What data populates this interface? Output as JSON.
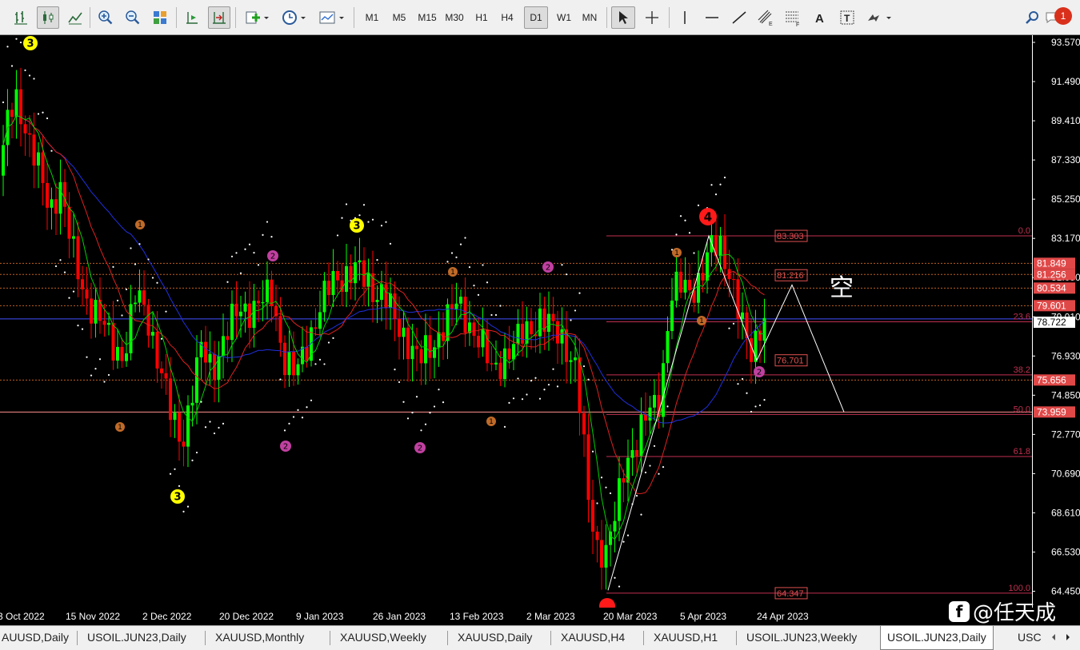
{
  "toolbar": {
    "timeframes": [
      "M1",
      "M5",
      "M15",
      "M30",
      "H1",
      "H4",
      "D1",
      "W1",
      "MN"
    ],
    "active_timeframe": "D1",
    "notifications_count": "1",
    "icons": [
      "bar-chart-icon",
      "candlestick-icon",
      "line-chart-icon",
      "zoom-in-icon",
      "zoom-out-icon",
      "tile-windows-icon",
      "autoscroll-icon",
      "chart-shift-icon",
      "new-order-icon",
      "periods-clock-icon",
      "templates-icon",
      "cursor-icon",
      "crosshair-icon",
      "vertical-line-icon",
      "horizontal-line-icon",
      "trendline-icon",
      "equidistant-channel-icon",
      "fibonacci-icon",
      "text-icon",
      "text-label-icon",
      "arrow-shapes-icon",
      "search-icon"
    ]
  },
  "price_axis": {
    "ticks": [
      "93.570",
      "91.490",
      "89.410",
      "87.330",
      "85.250",
      "83.170",
      "81.090",
      "79.010",
      "76.930",
      "74.850",
      "72.770",
      "70.690",
      "68.610",
      "66.530",
      "64.450"
    ],
    "labels": [
      {
        "text": "81.849",
        "color": "#e04848"
      },
      {
        "text": "81.256",
        "color": "#e04848"
      },
      {
        "text": "80.534",
        "color": "#e04848"
      },
      {
        "text": "79.601",
        "color": "#e04848"
      },
      {
        "text": "78.722",
        "color": "#ffffff"
      },
      {
        "text": "75.656",
        "color": "#e04848"
      },
      {
        "text": "73.959",
        "color": "#e04848"
      }
    ]
  },
  "time_axis": [
    "3 Oct 2022",
    "15 Nov 2022",
    "2 Dec 2022",
    "20 Dec 2022",
    "9 Jan 2023",
    "26 Jan 2023",
    "13 Feb 2023",
    "2 Mar 2023",
    "20 Mar 2023",
    "5 Apr 2023",
    "24 Apr 2023"
  ],
  "fibonacci": {
    "levels": [
      "0.0",
      "23.6",
      "38.2",
      "50.0",
      "61.8",
      "100.0"
    ],
    "boxes": [
      "83.303",
      "81.216",
      "76.701",
      "64.347"
    ]
  },
  "wave_labels": [
    {
      "text": "3",
      "kind": "yellow"
    },
    {
      "text": "3",
      "kind": "yellow"
    },
    {
      "text": "3",
      "kind": "yellow"
    },
    {
      "text": "4",
      "kind": "red"
    },
    {
      "text": "1",
      "kind": "orange"
    },
    {
      "text": "1",
      "kind": "orange"
    },
    {
      "text": "1",
      "kind": "orange"
    },
    {
      "text": "1",
      "kind": "orange"
    },
    {
      "text": "1",
      "kind": "orange"
    },
    {
      "text": "1",
      "kind": "orange"
    },
    {
      "text": "2",
      "kind": "purple"
    },
    {
      "text": "2",
      "kind": "purple"
    },
    {
      "text": "2",
      "kind": "purple"
    },
    {
      "text": "2",
      "kind": "purple"
    },
    {
      "text": "2",
      "kind": "purple"
    }
  ],
  "annotation": "空",
  "tabs": [
    "AUUSD,Daily",
    "USOIL.JUN23,Daily",
    "XAUUSD,Monthly",
    "XAUUSD,Weekly",
    "XAUUSD,Daily",
    "XAUUSD,H4",
    "XAUUSD,H1",
    "USOIL.JUN23,Weekly",
    "USOIL.JUN23,Daily",
    "USC"
  ],
  "active_tab": "USOIL.JUN23,Daily",
  "watermark": "@任天成",
  "colors": {
    "bull": "#00ff00",
    "bear": "#ff0000",
    "ma_fast": "#00d000",
    "ma_mid": "#e02020",
    "ma_slow": "#2030e0",
    "fib": "#c03050",
    "sar": "#ffffff"
  }
}
